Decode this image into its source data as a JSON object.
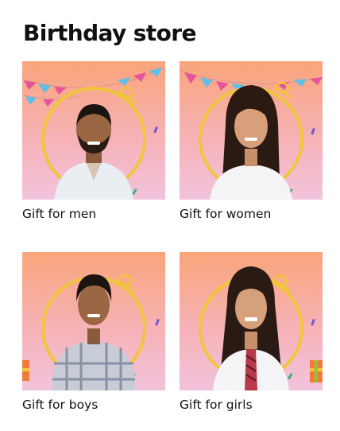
{
  "page": {
    "title": "Birthday store"
  },
  "tiles": [
    {
      "label": "Gift for men",
      "image": "man-portrait-birthday-banner"
    },
    {
      "label": "Gift for women",
      "image": "woman-portrait-birthday-banner"
    },
    {
      "label": "Gift for boys",
      "image": "boy-portrait-birthday-frame"
    },
    {
      "label": "Gift for girls",
      "image": "girl-portrait-birthday-frame"
    }
  ],
  "colors": {
    "gradient_top": "#f9a47a",
    "gradient_bottom": "#f2c3dc",
    "ring": "#f0c63a",
    "text": "#0f1111"
  }
}
